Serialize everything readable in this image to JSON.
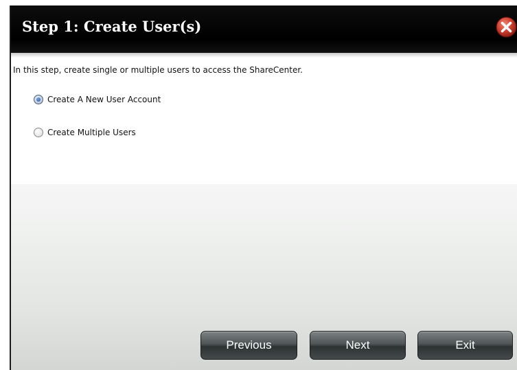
{
  "dialog": {
    "title": "Step 1: Create User(s)",
    "intro": "In this step, create single or multiple users to access the ShareCenter.",
    "options": [
      {
        "label": "Create A New User Account",
        "checked": true
      },
      {
        "label": "Create Multiple Users",
        "checked": false
      }
    ],
    "buttons": {
      "previous": "Previous",
      "next": "Next",
      "exit": "Exit"
    },
    "colors": {
      "titlebar": "#000000",
      "close_button": "#c0392b",
      "button_face": "#4f5556"
    },
    "icons": {
      "close": "close-icon"
    }
  }
}
